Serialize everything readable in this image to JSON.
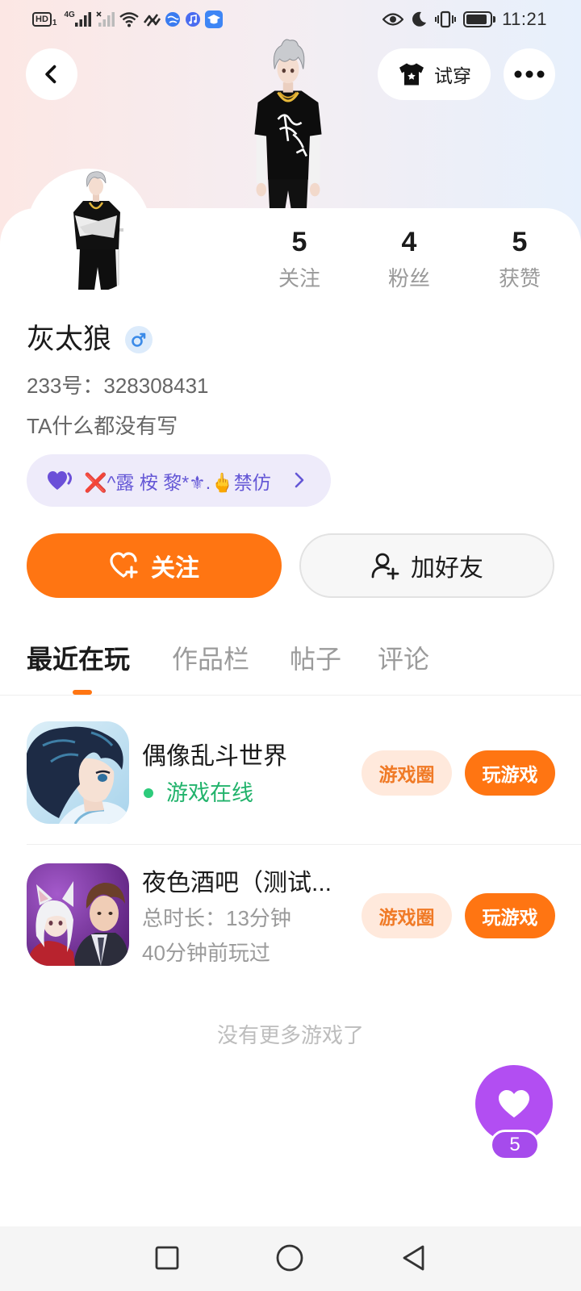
{
  "status_bar": {
    "hd_label": "HD",
    "sim_index": "1",
    "network_type": "4G",
    "time": "11:21",
    "battery_level": 0.9,
    "left_icons": [
      "hd-voice-icon",
      "signal-icon",
      "signal-no-sim-icon",
      "wifi-icon",
      "nfc-icon",
      "browser-icon",
      "music-icon",
      "education-icon"
    ],
    "right_icons": [
      "eye-comfort-icon",
      "do-not-disturb-icon",
      "vibrate-icon",
      "battery-icon"
    ]
  },
  "header": {
    "back_icon": "back-icon",
    "try_on_icon": "t-shirt-icon",
    "try_on_label": "试穿",
    "more_icon": "more-icon"
  },
  "profile": {
    "stats": [
      {
        "value": "5",
        "label": "关注"
      },
      {
        "value": "4",
        "label": "粉丝"
      },
      {
        "value": "5",
        "label": "获赞"
      }
    ],
    "name": "灰太狼",
    "gender_icon": "male-icon",
    "id_line": "233号：328308431",
    "bio": "TA什么都没有写",
    "badge": {
      "icon": "purple-heart-icon",
      "text": "❌^露 桉 黎*⚜.🖕禁仿",
      "chevron_icon": "chevron-right-icon"
    }
  },
  "actions": {
    "follow_icon": "heart-plus-icon",
    "follow_label": "关注",
    "add_friend_icon": "add-user-icon",
    "add_friend_label": "加好友"
  },
  "tabs": [
    {
      "label": "最近在玩",
      "active": true
    },
    {
      "label": "作品栏",
      "active": false
    },
    {
      "label": "帖子",
      "active": false
    },
    {
      "label": "评论",
      "active": false
    }
  ],
  "games": [
    {
      "title": "偶像乱斗世界",
      "status": "游戏在线",
      "circle_label": "游戏圈",
      "play_label": "玩游戏"
    },
    {
      "title": "夜色酒吧（测试...",
      "duration": "总时长：13分钟",
      "last_played": "40分钟前玩过",
      "circle_label": "游戏圈",
      "play_label": "玩游戏"
    }
  ],
  "list_end_text": "没有更多游戏了",
  "like_fab": {
    "icon": "heart-icon",
    "count": "5"
  },
  "nav_bar": {
    "icons": [
      "recent-apps-icon",
      "home-icon",
      "back-nav-icon"
    ]
  },
  "colors": {
    "accent": "#FF7512",
    "accent_soft": "#FFE9DC",
    "online_green": "#22B36C",
    "badge_purple": "#6457D6",
    "fab_purple": "#B24EF2"
  }
}
